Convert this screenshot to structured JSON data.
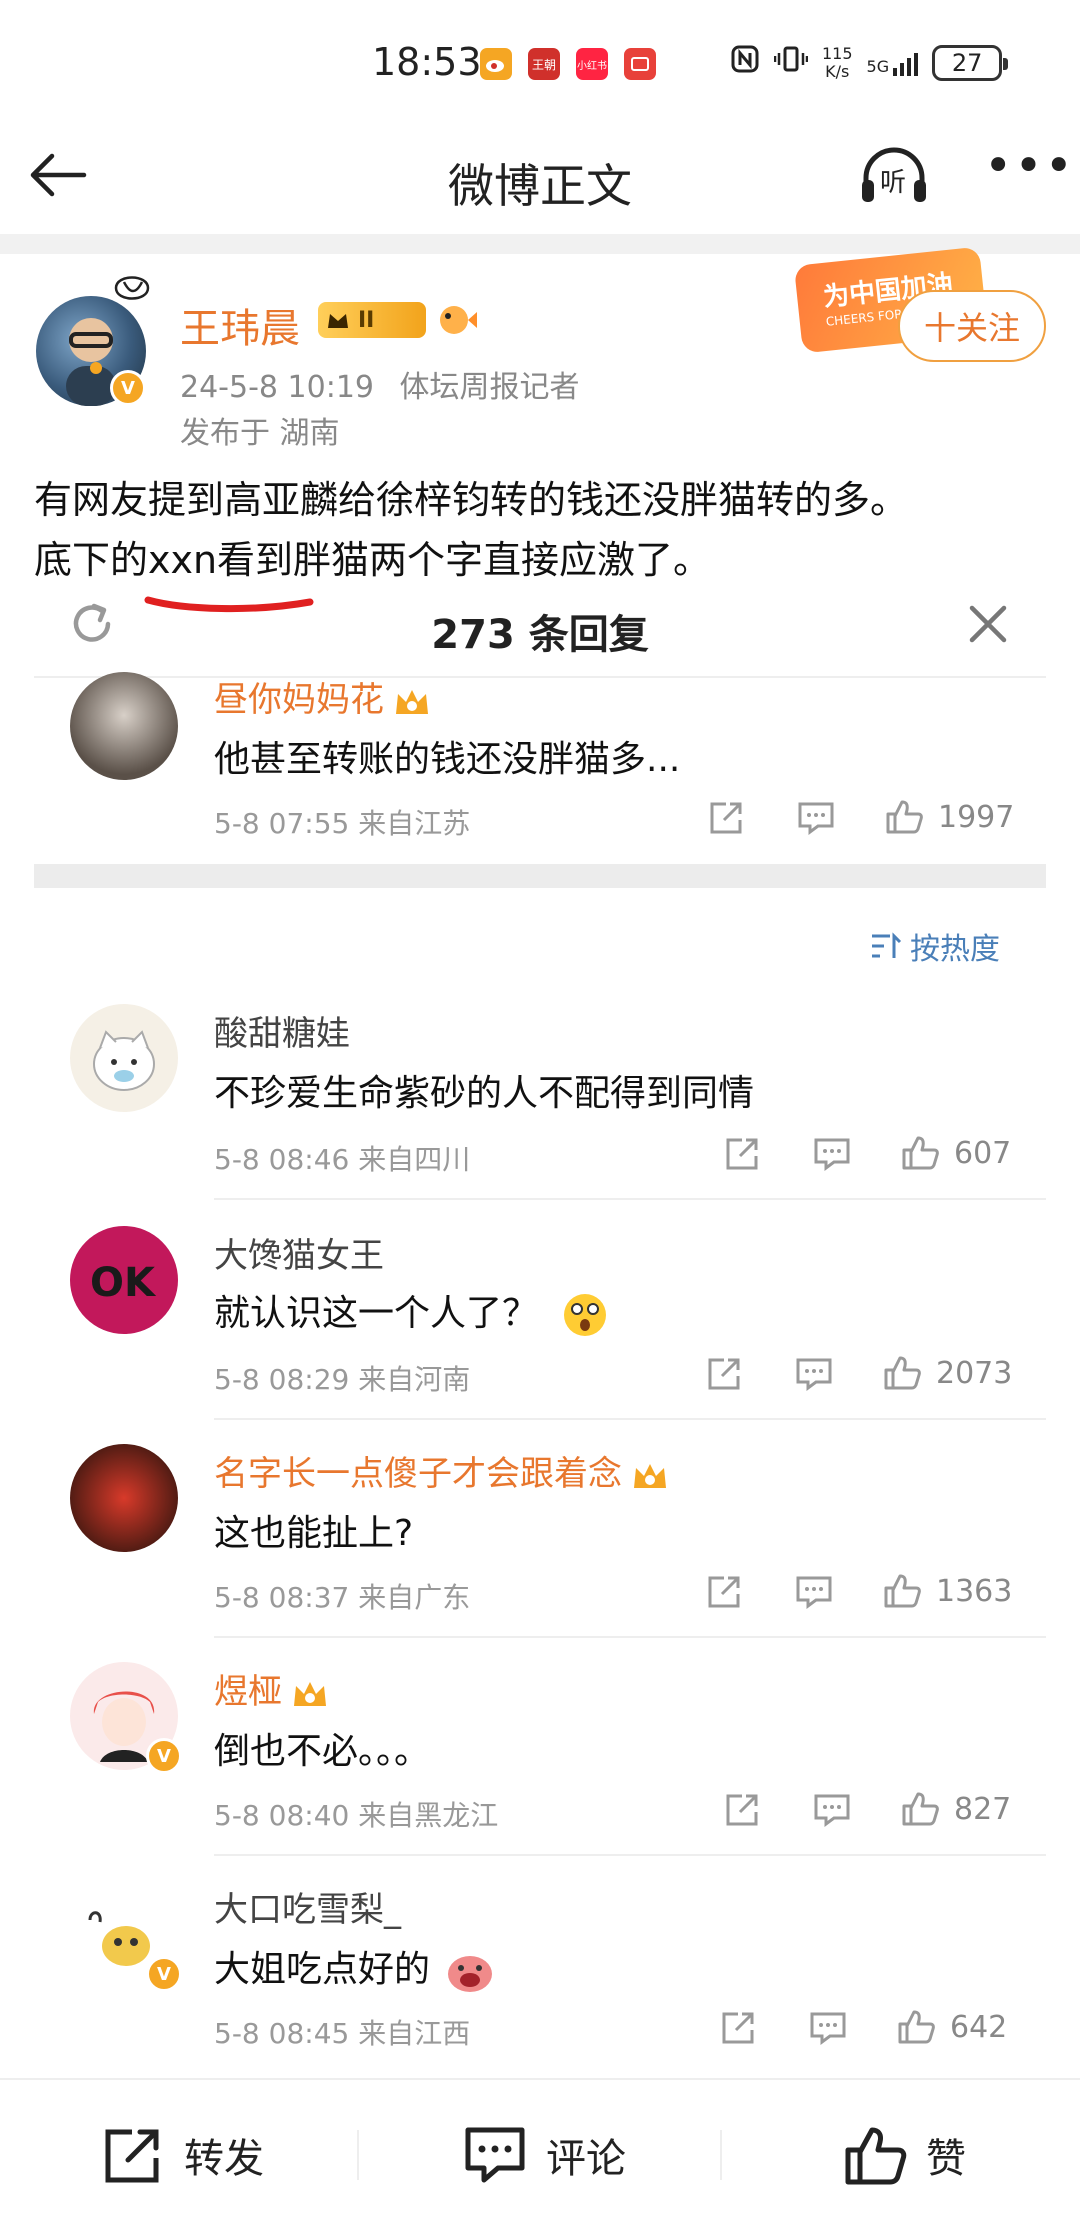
{
  "status_bar": {
    "time": "18:53",
    "apps": [
      {
        "icon": "weibo-app-icon",
        "label": "",
        "color": "#f5a623"
      },
      {
        "icon": "wangchao-app-icon",
        "label": "王朝",
        "color": "#d0302b"
      },
      {
        "icon": "xiaohongshu-app-icon",
        "label": "小红书",
        "color": "#ff2442"
      },
      {
        "icon": "red-app-icon",
        "label": "",
        "color": "#e8413a"
      }
    ],
    "net_speed_value": "115",
    "net_speed_unit": "K/s",
    "network": "5G",
    "battery": "27"
  },
  "nav": {
    "title": "微博正文",
    "listen_label": "听",
    "more_label": "•••"
  },
  "post": {
    "author": "王玮晨",
    "member_level": "II",
    "timestamp": "24-5-8 10:19",
    "source": "体坛周报记者",
    "location": "发布于 湖南",
    "follow_label": "十关注",
    "campaign_text": "为中国加油",
    "campaign_sub": "CHEERS FOR",
    "body_line1": "有网友提到高亚麟给徐梓钧转的钱还没胖猫转的多。",
    "body_line2": "底下的xxn看到胖猫两个字直接应激了。"
  },
  "replies": {
    "count_label": "273 条回复",
    "sort_label": "按热度"
  },
  "pinned_comment": {
    "name": "昼你妈妈花",
    "text": "他甚至转账的钱还没胖猫多...",
    "meta": "5-8 07:55 来自江苏",
    "likes": "1997"
  },
  "comments": [
    {
      "name": "酸甜糖娃",
      "text": "不珍爱生命紫砂的人不配得到同情",
      "meta": "5-8 08:46 来自四川",
      "likes": "607"
    },
    {
      "name": "大馋猫女王",
      "text": "就认识这一个人了？",
      "meta": "5-8 08:29 来自河南",
      "likes": "2073"
    },
    {
      "name": "名字长一点傻子才会跟着念",
      "text": "这也能扯上?",
      "meta": "5-8 08:37 来自广东",
      "likes": "1363"
    },
    {
      "name": "煜桠",
      "text": "倒也不必。。。",
      "meta": "5-8 08:40 来自黑龙江",
      "likes": "827"
    },
    {
      "name": "大口吃雪梨_",
      "text": "大姐吃点好的",
      "meta": "5-8 08:45 来自江西",
      "likes": "642"
    }
  ],
  "avatar_ok_text": "OK",
  "bottom_bar": {
    "repost_label": "转发",
    "comment_label": "评论",
    "like_label": "赞"
  },
  "colors": {
    "accent_orange": "#e8772e",
    "link_blue": "#4a7fb8",
    "underline_red": "#e02020"
  }
}
